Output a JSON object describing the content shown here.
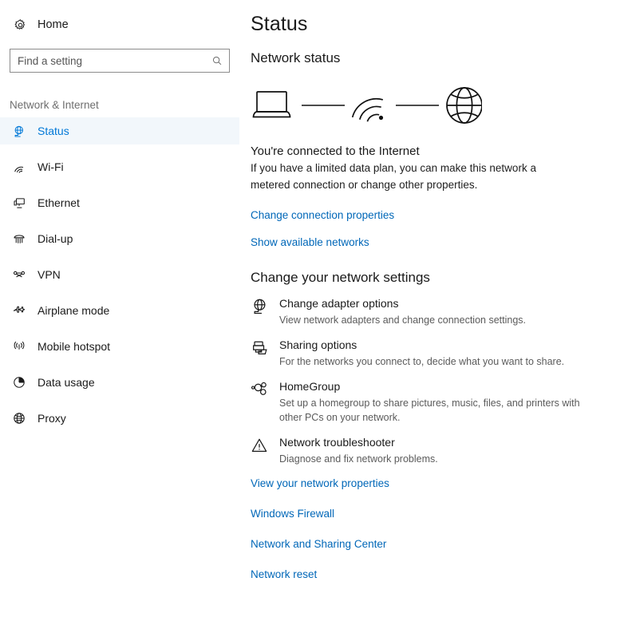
{
  "sidebar": {
    "home": {
      "label": "Home",
      "icon": "gear-icon"
    },
    "search": {
      "placeholder": "Find a setting",
      "value": "",
      "icon": "search-icon"
    },
    "section_title": "Network & Internet",
    "items": [
      {
        "label": "Status",
        "icon": "globe-monitor-icon",
        "selected": true
      },
      {
        "label": "Wi-Fi",
        "icon": "wifi-icon",
        "selected": false
      },
      {
        "label": "Ethernet",
        "icon": "ethernet-icon",
        "selected": false
      },
      {
        "label": "Dial-up",
        "icon": "dialup-icon",
        "selected": false
      },
      {
        "label": "VPN",
        "icon": "vpn-icon",
        "selected": false
      },
      {
        "label": "Airplane mode",
        "icon": "airplane-icon",
        "selected": false
      },
      {
        "label": "Mobile hotspot",
        "icon": "hotspot-icon",
        "selected": false
      },
      {
        "label": "Data usage",
        "icon": "data-usage-icon",
        "selected": false
      },
      {
        "label": "Proxy",
        "icon": "globe-icon",
        "selected": false
      }
    ]
  },
  "main": {
    "page_title": "Status",
    "network_status_heading": "Network status",
    "diagram": {
      "device_icon": "laptop-icon",
      "link_icon": "connection-line",
      "signal_icon": "wifi-signal-icon",
      "internet_icon": "globe-icon"
    },
    "connection_state": "You're connected to the Internet",
    "connection_description": "If you have a limited data plan, you can make this network a metered connection or change other properties.",
    "change_connection_link": "Change connection properties",
    "show_networks_link": "Show available networks",
    "settings_heading": "Change your network settings",
    "options": [
      {
        "title": "Change adapter options",
        "desc": "View network adapters and change connection settings.",
        "icon": "adapter-globe-icon"
      },
      {
        "title": "Sharing options",
        "desc": "For the networks you connect to, decide what you want to share.",
        "icon": "sharing-icon"
      },
      {
        "title": "HomeGroup",
        "desc": "Set up a homegroup to share pictures, music, files, and printers with other PCs on your network.",
        "icon": "homegroup-icon"
      },
      {
        "title": "Network troubleshooter",
        "desc": "Diagnose and fix network problems.",
        "icon": "warning-triangle-icon"
      }
    ],
    "bottom_links": [
      "View your network properties",
      "Windows Firewall",
      "Network and Sharing Center",
      "Network reset"
    ]
  },
  "colors": {
    "accent": "#0078d7",
    "link": "#0067b8",
    "selected_bg": "#f2f7fb",
    "text": "#1a1a1a",
    "muted_text": "#5b5b5b",
    "background": "#ffffff"
  }
}
